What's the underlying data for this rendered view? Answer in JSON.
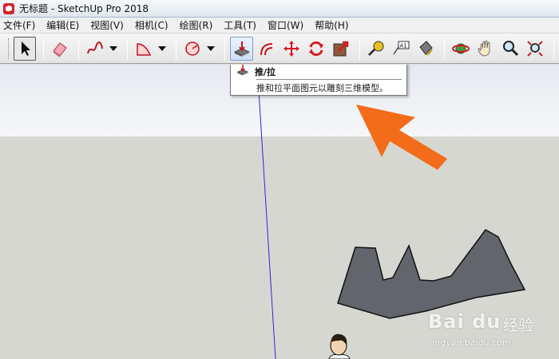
{
  "window": {
    "title": "无标题 - SketchUp Pro 2018"
  },
  "menu": [
    {
      "label": "文件(F)"
    },
    {
      "label": "编辑(E)"
    },
    {
      "label": "视图(V)"
    },
    {
      "label": "相机(C)"
    },
    {
      "label": "绘图(R)"
    },
    {
      "label": "工具(T)"
    },
    {
      "label": "窗口(W)"
    },
    {
      "label": "帮助(H)"
    }
  ],
  "toolbar": {
    "tools": [
      "select-tool",
      "eraser-tool",
      "freehand-tool",
      "arc-tool",
      "shapes-tool",
      "push-pull-tool",
      "offset-tool",
      "move-tool",
      "rotate-tool",
      "scale-tool",
      "tape-measure-tool",
      "dimension-text-tool",
      "paint-bucket-tool",
      "orbit-tool",
      "pan-tool",
      "zoom-tool",
      "zoom-extents-tool"
    ],
    "selected": "select-tool",
    "hovered": "push-pull-tool"
  },
  "tooltip": {
    "title": "推/拉",
    "description": "推和拉平面图元以雕刻三维模型。"
  },
  "watermark": {
    "brand": "Bai du",
    "brand_cn": "经验",
    "url": "jingyan.baidu.com"
  },
  "colors": {
    "accent_arrow": "#f26c1a",
    "shape_fill": "#62666c",
    "sky": "#eef0f3",
    "ground": "#d7d7d1",
    "axis_blue": "#2a2ad8"
  }
}
